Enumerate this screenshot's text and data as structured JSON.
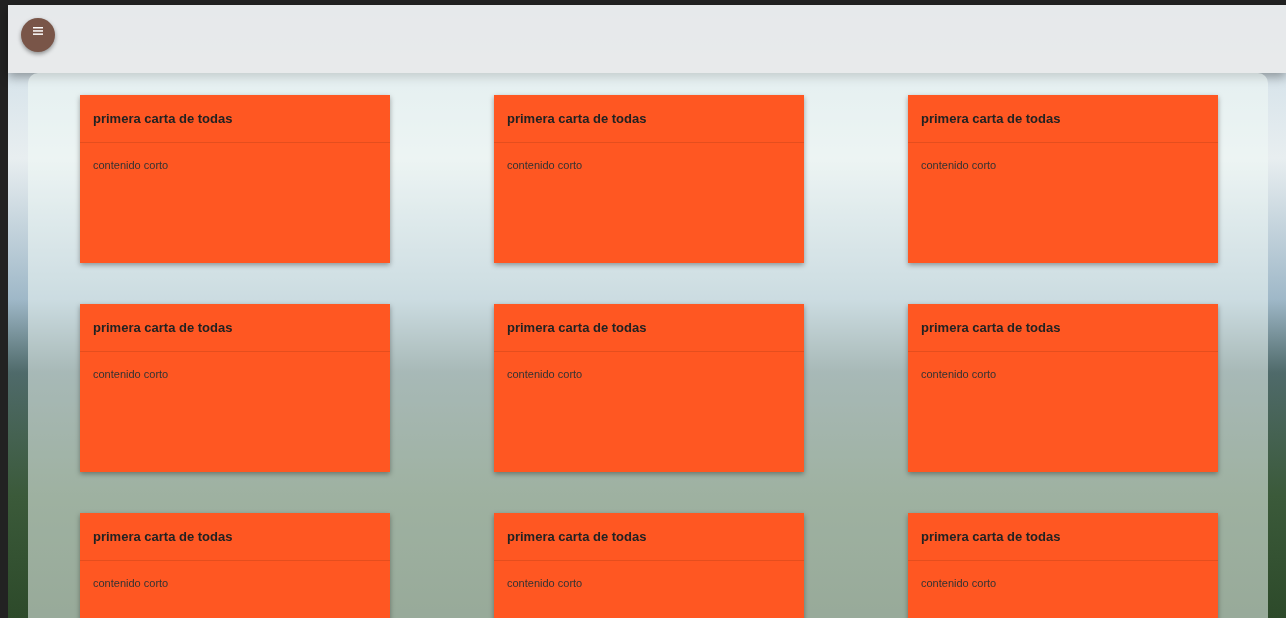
{
  "cards": [
    {
      "title": "primera carta de todas",
      "content": "contenido corto"
    },
    {
      "title": "primera carta de todas",
      "content": "contenido corto"
    },
    {
      "title": "primera carta de todas",
      "content": "contenido corto"
    },
    {
      "title": "primera carta de todas",
      "content": "contenido corto"
    },
    {
      "title": "primera carta de todas",
      "content": "contenido corto"
    },
    {
      "title": "primera carta de todas",
      "content": "contenido corto"
    },
    {
      "title": "primera carta de todas",
      "content": "contenido corto"
    },
    {
      "title": "primera carta de todas",
      "content": "contenido corto"
    },
    {
      "title": "primera carta de todas",
      "content": "contenido corto"
    }
  ]
}
